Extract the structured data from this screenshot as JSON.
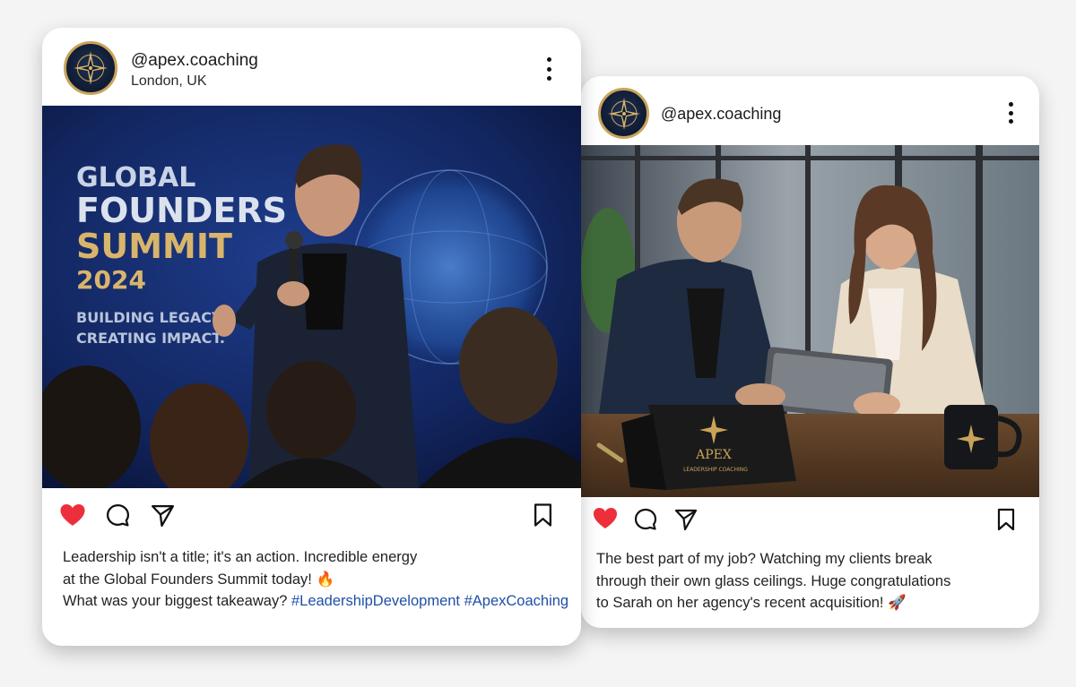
{
  "posts": [
    {
      "username": "@apex.coaching",
      "location": "London, UK",
      "image_text": {
        "banner_line1": "GLOBAL",
        "banner_line2": "FOUNDERS",
        "banner_line3": "SUMMIT",
        "banner_year": "2024",
        "tagline1": "BUILDING LEGACY.",
        "tagline2": "CREATING IMPACT."
      },
      "liked": true,
      "caption_line1": "Leadership isn't a title; it's an action. Incredible energy",
      "caption_line2": "at the Global Founders Summit today! 🔥",
      "caption_line3": "What was your biggest takeaway? ",
      "hashtags": "#LeadershipDevelopment #ApexCoaching"
    },
    {
      "username": "@apex.coaching",
      "image_text": {
        "notebook_brand": "APEX",
        "notebook_sub": "LEADERSHIP COACHING"
      },
      "liked": true,
      "caption_line1": "The best part of my job? Watching my clients break",
      "caption_line2": "through their own glass ceilings. Huge congratulations",
      "caption_line3": "to Sarah on her agency's recent acquisition! 🚀"
    }
  ],
  "colors": {
    "like": "#ed2f3c",
    "hashtag": "#1f4fa8",
    "brand_gold": "#c9a35a",
    "brand_navy": "#0f1b33"
  },
  "icons": [
    "heart-icon",
    "comment-icon",
    "share-icon",
    "bookmark-icon",
    "more-options-icon",
    "compass-logo-icon"
  ]
}
